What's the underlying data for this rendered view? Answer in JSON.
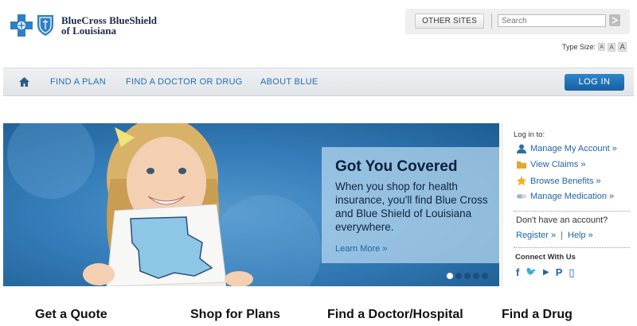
{
  "brand": {
    "name_line1": "BlueCross BlueShield",
    "name_line2": "of Louisiana",
    "cross_color": "#2f7fc4",
    "shield_color": "#2f7fc4"
  },
  "utility": {
    "other_sites_label": "OTHER SITES",
    "search_placeholder": "Search",
    "search_icon": "search-go-icon",
    "type_size_label": "Type Size:",
    "type_size_options": [
      "A",
      "A",
      "A"
    ]
  },
  "nav": {
    "home_icon": "home-icon",
    "items": [
      "FIND A PLAN",
      "FIND A DOCTOR OR DRUG",
      "ABOUT BLUE"
    ],
    "login_label": "LOG IN",
    "accent": "#1f6fb5"
  },
  "hero": {
    "title": "Got You Covered",
    "body": "When you shop for health insurance, you'll find Blue Cross and Blue Shield of Louisiana everywhere.",
    "link": "Learn More »",
    "slides_total": 5,
    "active_slide": 1
  },
  "side": {
    "login_label": "Log in to:",
    "links": [
      {
        "label": "Manage My Account »",
        "icon": "person-icon"
      },
      {
        "label": "View Claims »",
        "icon": "folder-icon"
      },
      {
        "label": "Browse Benefits »",
        "icon": "star-icon"
      },
      {
        "label": "Manage Medication »",
        "icon": "pill-icon"
      }
    ],
    "no_account": "Don't have an account?",
    "register": "Register »",
    "separator": "|",
    "help": "Help »",
    "connect_label": "Connect With Us",
    "social": [
      {
        "glyph": "f",
        "icon": "facebook-icon"
      },
      {
        "glyph": "🐦",
        "icon": "twitter-icon"
      },
      {
        "glyph": "▶",
        "icon": "youtube-icon"
      },
      {
        "glyph": "P",
        "icon": "pinterest-icon"
      },
      {
        "glyph": "▯",
        "icon": "mobile-icon"
      }
    ]
  },
  "cards": [
    "Get a Quote",
    "Shop for Plans",
    "Find a Doctor/Hospital",
    "Find a Drug"
  ]
}
